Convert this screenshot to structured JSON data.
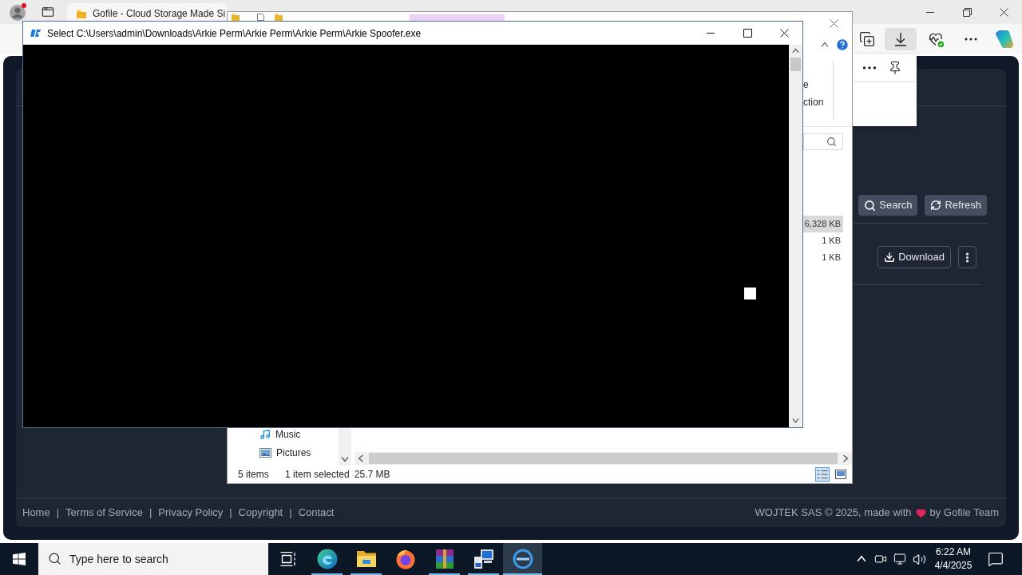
{
  "browser": {
    "tabs": [
      {
        "title": "Gofile - Cloud Storage Made Si",
        "selected": true
      }
    ]
  },
  "page": {
    "search_actions": [
      {
        "kind": "search",
        "label": "Search"
      },
      {
        "kind": "refresh",
        "label": "Refresh"
      }
    ],
    "file_actions": [
      {
        "kind": "download",
        "label": "Download"
      },
      {
        "kind": "more"
      }
    ],
    "footer": {
      "links": [
        "Home",
        "Terms of Service",
        "Privacy Policy",
        "Copyright",
        "Contact"
      ],
      "separators": [
        "|",
        "|",
        "|",
        "|"
      ],
      "credit_start": "WOJTEK SAS © 2025, made with",
      "credit_end": "by Gofile Team"
    }
  },
  "explorer": {
    "ribbon_fragments": [
      "e",
      "ction"
    ],
    "file_sizes": [
      {
        "size": "6,328 KB",
        "selected": true
      },
      {
        "size": "1 KB",
        "selected": false
      },
      {
        "size": "1 KB",
        "selected": false
      }
    ],
    "nav_items": [
      {
        "kind": "music",
        "label": "Music"
      },
      {
        "kind": "pictures",
        "label": "Pictures"
      }
    ],
    "status_bar": {
      "item_count": "5 items",
      "selection": "1 item selected",
      "selection_size": "25.7 MB"
    },
    "views": [
      {
        "kind": "details",
        "selected": true
      },
      {
        "kind": "large_icons",
        "selected": false
      }
    ]
  },
  "console": {
    "title": "Select C:\\Users\\admin\\Downloads\\Arkie Perm\\Arkie Perm\\Arkie Perm\\Arkie Spoofer.exe"
  },
  "taskbar": {
    "search_placeholder": "Type here to search",
    "apps": [
      {
        "kind": "task_view",
        "running": false,
        "selected": false
      },
      {
        "kind": "edge",
        "running": true,
        "selected": false
      },
      {
        "kind": "file_explorer",
        "running": true,
        "selected": false
      },
      {
        "kind": "firefox",
        "running": false,
        "selected": false
      },
      {
        "kind": "winrar",
        "running": true,
        "selected": false
      },
      {
        "kind": "network_app",
        "running": true,
        "selected": false
      },
      {
        "kind": "console_app",
        "running": true,
        "selected": true
      }
    ],
    "time": "6:22 AM",
    "date": "4/4/2025"
  }
}
